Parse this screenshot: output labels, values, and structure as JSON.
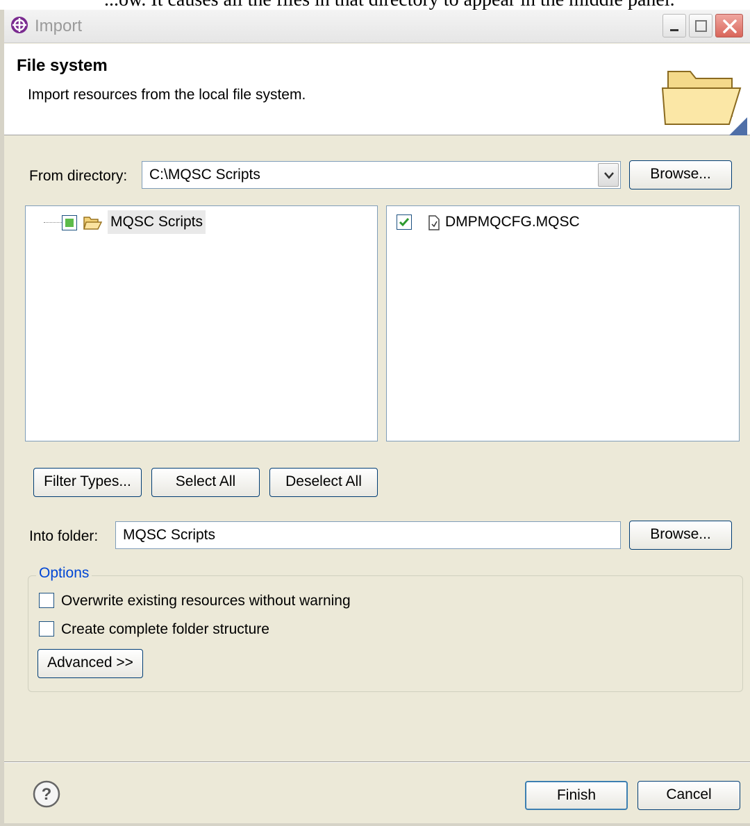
{
  "document": {
    "partial_caption": "...ow. It causes all the files in that directory to appear in the middle panel."
  },
  "window": {
    "title": "Import",
    "controls": [
      "minimize-icon",
      "maximize-icon",
      "close-icon"
    ]
  },
  "banner": {
    "title": "File system",
    "description": "Import resources from the local file system."
  },
  "from_directory": {
    "label": "From directory:",
    "value": "C:\\MQSC Scripts",
    "browse_label": "Browse..."
  },
  "tree": {
    "items": [
      {
        "label": "MQSC Scripts",
        "state": "partial"
      }
    ]
  },
  "files": {
    "items": [
      {
        "label": "DMPMQCFG.MQSC",
        "checked": true
      }
    ]
  },
  "selection_buttons": {
    "filter_types": "Filter Types...",
    "select_all": "Select All",
    "deselect_all": "Deselect All"
  },
  "into_folder": {
    "label": "Into folder:",
    "value": "MQSC Scripts",
    "browse_label": "Browse..."
  },
  "options": {
    "legend": "Options",
    "overwrite_label": "Overwrite existing resources without warning",
    "overwrite_checked": false,
    "create_structure_label": "Create complete folder structure",
    "create_structure_checked": false,
    "advanced_label": "Advanced >>"
  },
  "footer": {
    "finish_label": "Finish",
    "cancel_label": "Cancel"
  },
  "colors": {
    "legend_blue": "#0046d5",
    "check_green": "#2e9a2e",
    "dialog_bg": "#ece9d8"
  }
}
